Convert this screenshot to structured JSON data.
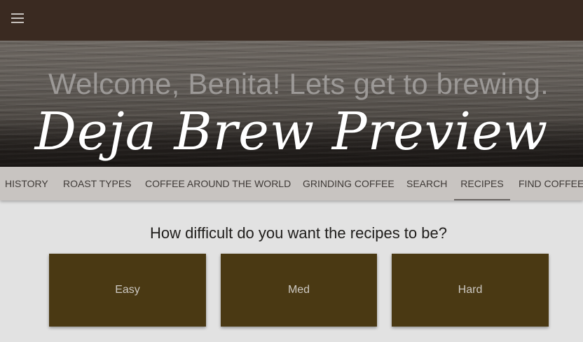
{
  "topbar": {
    "menu_icon": "hamburger-menu-icon"
  },
  "hero": {
    "welcome": "Welcome, Benita! Lets get to brewing.",
    "brand": "Deja Brew Preview"
  },
  "tabs": [
    {
      "label": "HISTORY"
    },
    {
      "label": "ROAST TYPES"
    },
    {
      "label": "COFFEE AROUND THE WORLD"
    },
    {
      "label": "GRINDING COFFEE"
    },
    {
      "label": "SEARCH"
    },
    {
      "label": "RECIPES",
      "active": true
    },
    {
      "label": "FIND COFFEE"
    }
  ],
  "main": {
    "question": "How difficult do you want the recipes to be?",
    "difficulty": [
      "Easy",
      "Med",
      "Hard"
    ]
  },
  "colors": {
    "topbar": "#3a2a21",
    "tabbar": "#c8c4c1",
    "card": "#4a3913",
    "page": "#e2e2e2"
  }
}
